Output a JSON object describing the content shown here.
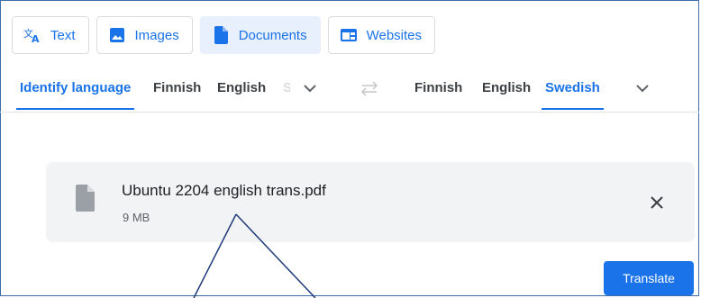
{
  "mode_tabs": [
    {
      "label": "Text",
      "icon": "translate-icon",
      "active": false
    },
    {
      "label": "Images",
      "icon": "image-icon",
      "active": false
    },
    {
      "label": "Documents",
      "icon": "document-icon",
      "active": true
    },
    {
      "label": "Websites",
      "icon": "website-icon",
      "active": false
    }
  ],
  "source_languages": {
    "detect": "Identify language",
    "items": [
      "Finnish",
      "English"
    ],
    "faded_item": "Swedish"
  },
  "target_languages": {
    "items": [
      "Finnish",
      "English",
      "Swedish"
    ],
    "selected": "Swedish"
  },
  "file": {
    "name": "Ubuntu 2204 english trans.pdf",
    "size": "9 MB"
  },
  "actions": {
    "translate_label": "Translate"
  },
  "colors": {
    "accent": "#1a73e8",
    "active_tab_bg": "#e8f0fe",
    "card_bg": "#f1f3f4",
    "annotation_line": "#1f3a78"
  }
}
